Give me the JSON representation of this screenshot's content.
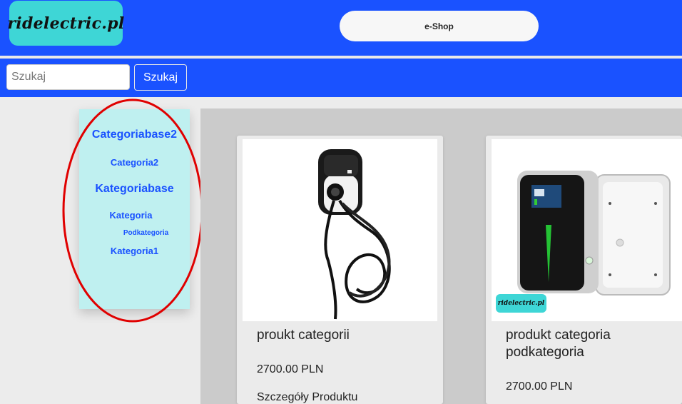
{
  "header": {
    "logo_text": "ridelectric.pl",
    "shop_label": "e-Shop"
  },
  "search": {
    "placeholder": "Szukaj",
    "button_label": "Szukaj"
  },
  "sidebar": {
    "items": [
      {
        "label": "Categoriabase2",
        "level": "base"
      },
      {
        "label": "Categoria2",
        "level": "category"
      },
      {
        "label": "Kategoriabase",
        "level": "base"
      },
      {
        "label": "Kategoria",
        "level": "category"
      },
      {
        "label": "Podkategoria",
        "level": "subcategory"
      },
      {
        "label": "Kategoria1",
        "level": "category"
      }
    ]
  },
  "products": [
    {
      "name": "proukt categorii",
      "price": "2700.00 PLN",
      "details_label": "Szczegóły Produktu",
      "image": "wall-charger-with-cable-icon"
    },
    {
      "name": "produkt categoria podkategoria",
      "price": "2700.00 PLN",
      "image": "wallbox-charger-icon",
      "image_badge": "ridelectric.pl"
    }
  ],
  "colors": {
    "brand_blue": "#1a52ff",
    "logo_teal": "#3ed6d6",
    "sidebar_bg": "#bff0f0",
    "annotation_red": "#e00000"
  }
}
